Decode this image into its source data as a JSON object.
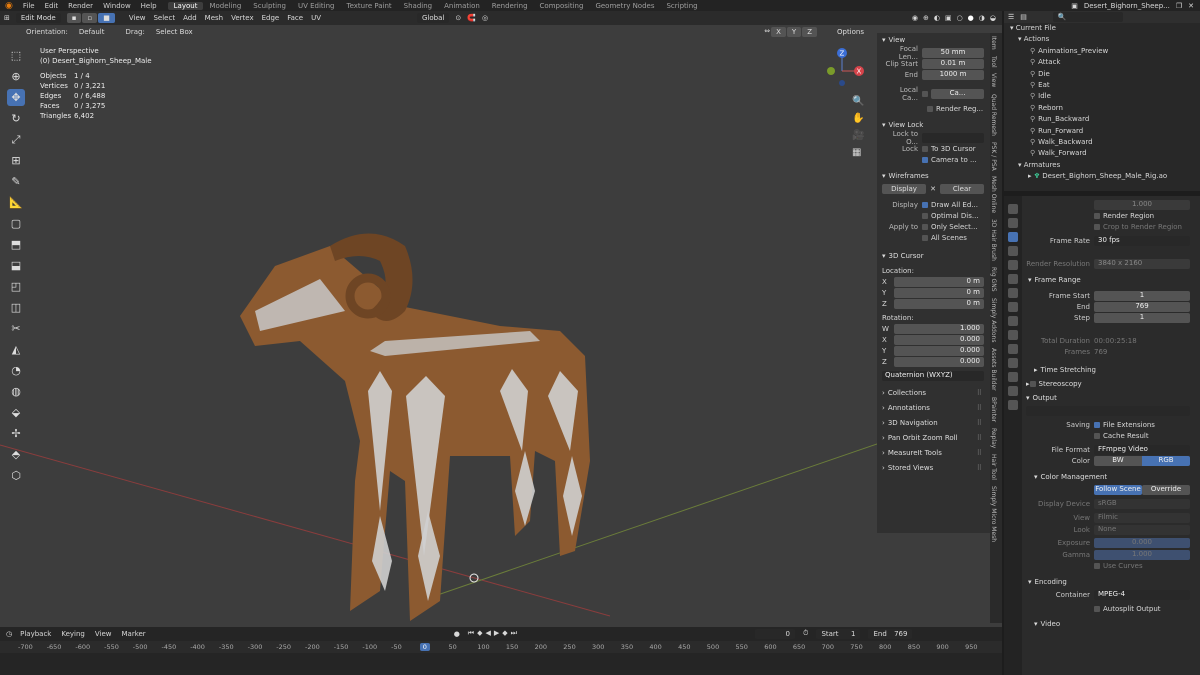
{
  "menu": [
    "File",
    "Edit",
    "Render",
    "Window",
    "Help"
  ],
  "workspaces": [
    "Layout",
    "Modeling",
    "Sculpting",
    "UV Editing",
    "Texture Paint",
    "Shading",
    "Animation",
    "Rendering",
    "Compositing",
    "Geometry Nodes",
    "Scripting"
  ],
  "active_workspace": "Layout",
  "scene_name": "Desert_Bighorn_Sheep...",
  "viewport": {
    "mode": "Edit Mode",
    "header_menu": [
      "View",
      "Select",
      "Add",
      "Mesh",
      "Vertex",
      "Edge",
      "Face",
      "UV"
    ],
    "transform": "Global",
    "orientation_label": "Orientation:",
    "orientation": "Default",
    "drag_label": "Drag:",
    "drag": "Select Box",
    "axis_buttons": [
      "X",
      "Y",
      "Z"
    ],
    "options": "Options",
    "perspective": "User Perspective",
    "object": "(0) Desert_Bighorn_Sheep_Male",
    "stats": [
      {
        "k": "Objects",
        "v": "1 / 4"
      },
      {
        "k": "Vertices",
        "v": "0 / 3,221"
      },
      {
        "k": "Edges",
        "v": "0 / 6,488"
      },
      {
        "k": "Faces",
        "v": "0 / 3,275"
      },
      {
        "k": "Triangles",
        "v": "6,402"
      }
    ]
  },
  "npanel": {
    "view": "View",
    "focal": "Focal Len...",
    "focal_v": "50 mm",
    "clip": "Clip Start",
    "clip_v": "0.01 m",
    "end": "End",
    "end_v": "1000 m",
    "local": "Local Ca...",
    "local_v": "Ca...",
    "render_reg": "Render Reg...",
    "viewlock": "View Lock",
    "lockto": "Lock to O...",
    "lock": "Lock",
    "to3d": "To 3D Cursor",
    "camto": "Camera to ...",
    "wire": "Wireframes",
    "display": "Display",
    "clear": "Clear",
    "disp_lbl": "Display",
    "draw_all": "Draw All Ed...",
    "optimal": "Optimal Dis...",
    "apply": "Apply to",
    "only_sel": "Only Select...",
    "all_scenes": "All Scenes",
    "cursor": "3D Cursor",
    "location": "Location:",
    "x": "X",
    "y": "Y",
    "z": "Z",
    "w": "W",
    "m0": "0 m",
    "rotation": "Rotation:",
    "r1": "1.000",
    "r0": "0.000",
    "quat": "Quaternion (WXYZ)",
    "sections": [
      "Collections",
      "Annotations",
      "3D Navigation",
      "Pan Orbit Zoom Roll",
      "MeasureIt Tools",
      "Stored Views"
    ]
  },
  "vtabs": [
    "Item",
    "Tool",
    "View",
    "Quad Remesh",
    "PSK / PSA",
    "Mesh Online",
    "3D Hair Brush",
    "Rig GNS",
    "Simply Addons",
    "Assets Builder",
    "BPainter",
    "Replay",
    "Hair Tool",
    "Simply Micro Mesh"
  ],
  "outliner": {
    "current": "Current File",
    "actions": "Actions",
    "items": [
      "Animations_Preview",
      "Attack",
      "Die",
      "Eat",
      "Idle",
      "Reborn",
      "Run_Backward",
      "Run_Forward",
      "Walk_Backward",
      "Walk_Forward"
    ],
    "armatures": "Armatures",
    "arm_item": "Desert_Bighorn_Sheep_Male_Rig.ao"
  },
  "props": {
    "top_val": "1.000",
    "render_region": "Render Region",
    "crop": "Crop to Render Region",
    "frame_rate": "Frame Rate",
    "fps": "30 fps",
    "resolution": "Render Resolution",
    "res_v": "3840 x 2160",
    "frame_range": "Frame Range",
    "fstart": "Frame Start",
    "fstart_v": "1",
    "fend": "End",
    "fend_v": "769",
    "step": "Step",
    "step_v": "1",
    "total": "Total Duration",
    "total_v": "00:00:25:18",
    "frames": "Frames",
    "frames_v": "769",
    "time_str": "Time Stretching",
    "stereo": "Stereoscopy",
    "output": "Output",
    "saving": "Saving",
    "file_ext": "File Extensions",
    "cache": "Cache Result",
    "ffmt": "File Format",
    "ffmt_v": "FFmpeg Video",
    "color": "Color",
    "bw": "BW",
    "rgb": "RGB",
    "cm": "Color Management",
    "follow": "Follow Scene",
    "override": "Override",
    "dd": "Display Device",
    "dd_v": "sRGB",
    "view": "View",
    "view_v": "Filmic",
    "look": "Look",
    "look_v": "None",
    "exposure": "Exposure",
    "exp_v": "0.000",
    "gamma": "Gamma",
    "gam_v": "1.000",
    "curves": "Use Curves",
    "encoding": "Encoding",
    "container": "Container",
    "cont_v": "MPEG-4",
    "autosplit": "Autosplit Output",
    "video": "Video"
  },
  "timeline": {
    "menu": [
      "Playback",
      "Keying",
      "View",
      "Marker"
    ],
    "frame": "0",
    "start_lbl": "Start",
    "start": "1",
    "end_lbl": "End",
    "end": "769",
    "ticks": [
      "-700",
      "-650",
      "-600",
      "-550",
      "-500",
      "-450",
      "-400",
      "-350",
      "-300",
      "-250",
      "-200",
      "-150",
      "-100",
      "-50",
      "0",
      "50",
      "100",
      "150",
      "200",
      "250",
      "300",
      "350",
      "400",
      "450",
      "500",
      "550",
      "600",
      "650",
      "700",
      "750",
      "800",
      "850",
      "900",
      "950"
    ]
  },
  "colors": {
    "accent": "#4772b3",
    "viewport_bg": "#3d3d3d"
  }
}
